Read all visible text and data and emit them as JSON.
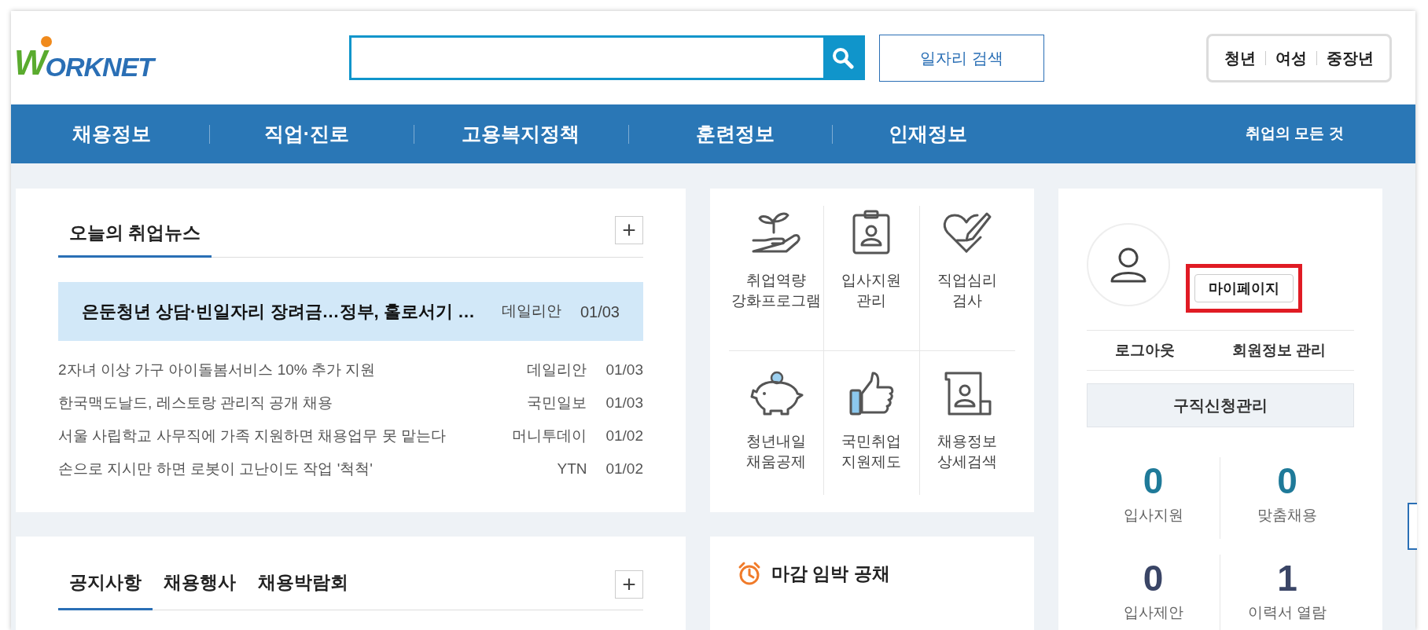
{
  "header": {
    "logo": {
      "mark": "W",
      "text": "ORKNET"
    },
    "search": {
      "button": "일자리 검색"
    },
    "segments": [
      "청년",
      "여성",
      "중장년"
    ]
  },
  "nav": {
    "items": [
      "채용정보",
      "직업·진로",
      "고용복지정책",
      "훈련정보",
      "인재정보"
    ],
    "extra": "취업의 모든 것"
  },
  "news": {
    "title": "오늘의 취업뉴스",
    "more": "+",
    "featured": {
      "title": "은둔청년 상담·빈일자리 장려금…정부, 홀로서기 …",
      "source": "데일리안",
      "date": "01/03"
    },
    "items": [
      {
        "title": "2자녀 이상 가구 아이돌봄서비스 10% 추가 지원",
        "source": "데일리안",
        "date": "01/03"
      },
      {
        "title": "한국맥도날드, 레스토랑 관리직 공개 채용",
        "source": "국민일보",
        "date": "01/03"
      },
      {
        "title": "서울 사립학교 사무직에 가족 지원하면 채용업무 못 맡는다",
        "source": "머니투데이",
        "date": "01/02"
      },
      {
        "title": "손으로 지시만 하면 로봇이 고난이도 작업 '척척'",
        "source": "YTN",
        "date": "01/02"
      }
    ]
  },
  "quick_links": [
    {
      "kind": "sprout",
      "lines": [
        "취업역량",
        "강화프로그램"
      ]
    },
    {
      "kind": "badge",
      "lines": [
        "입사지원",
        "관리"
      ]
    },
    {
      "kind": "heart",
      "lines": [
        "직업심리",
        "검사"
      ]
    },
    {
      "kind": "piggy",
      "lines": [
        "청년내일",
        "채움공제"
      ]
    },
    {
      "kind": "thumb",
      "lines": [
        "국민취업",
        "지원제도"
      ]
    },
    {
      "kind": "document",
      "lines": [
        "채용정보",
        "상세검색"
      ]
    }
  ],
  "notices": {
    "tabs": [
      {
        "label": "공지사항",
        "selected": true
      },
      {
        "label": "채용행사",
        "selected": false
      },
      {
        "label": "채용박람회",
        "selected": false
      }
    ],
    "more": "+"
  },
  "deadline": {
    "title": "마감 임박 공채"
  },
  "profile": {
    "mypage": {
      "label": "마이페이지",
      "highlighted": true
    },
    "links": [
      "로그아웃",
      "회원정보 관리"
    ],
    "manage": "구직신청관리",
    "stats": [
      {
        "value": "0",
        "label": "입사지원",
        "color": "#1f7a99"
      },
      {
        "value": "0",
        "label": "맞춤채용",
        "color": "#1f7a99"
      },
      {
        "value": "0",
        "label": "입사제안",
        "color": "#3a4566"
      },
      {
        "value": "1",
        "label": "이력서 열람",
        "color": "#3a4566"
      }
    ]
  }
}
